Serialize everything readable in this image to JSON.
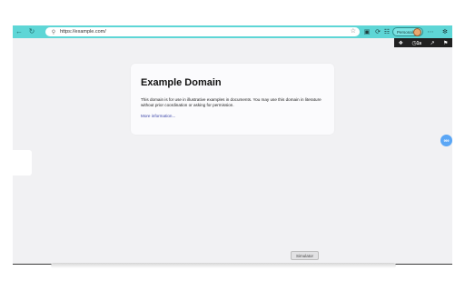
{
  "browser": {
    "url": "https://example.com/",
    "profile_label": "Personal",
    "back_icon": "arrow-left",
    "refresh_icon": "refresh",
    "accent_color": "#5ed6d6"
  },
  "extensions_bar": {
    "timer_label": "1s"
  },
  "card": {
    "title": "Example Domain",
    "body": "This domain is for use in illustrative examples in documents. You may use this domain in literature without prior coordination or asking for permission.",
    "link_text": "More information..."
  },
  "floating_button": {
    "label": "999"
  },
  "simulator_button": {
    "label": "Simulator"
  }
}
